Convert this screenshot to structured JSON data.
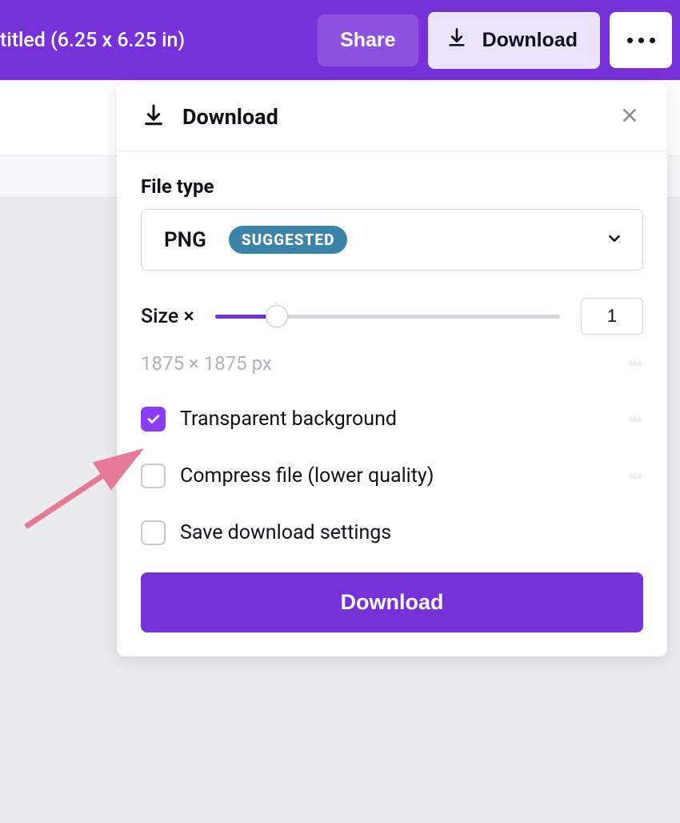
{
  "topbar": {
    "title": "titled (6.25 x 6.25 in)",
    "share_label": "Share",
    "download_label": "Download"
  },
  "panel": {
    "title": "Download",
    "filetype_label": "File type",
    "filetype_value": "PNG",
    "filetype_badge": "SUGGESTED",
    "size_label": "Size ×",
    "size_value": "1",
    "dimensions": "1875 × 1875 px",
    "options": {
      "transparent": {
        "label": "Transparent background",
        "checked": true,
        "premium": true
      },
      "compress": {
        "label": "Compress file (lower quality)",
        "checked": false,
        "premium": true
      },
      "save_settings": {
        "label": "Save download settings",
        "checked": false,
        "premium": false
      }
    },
    "download_button": "Download"
  }
}
